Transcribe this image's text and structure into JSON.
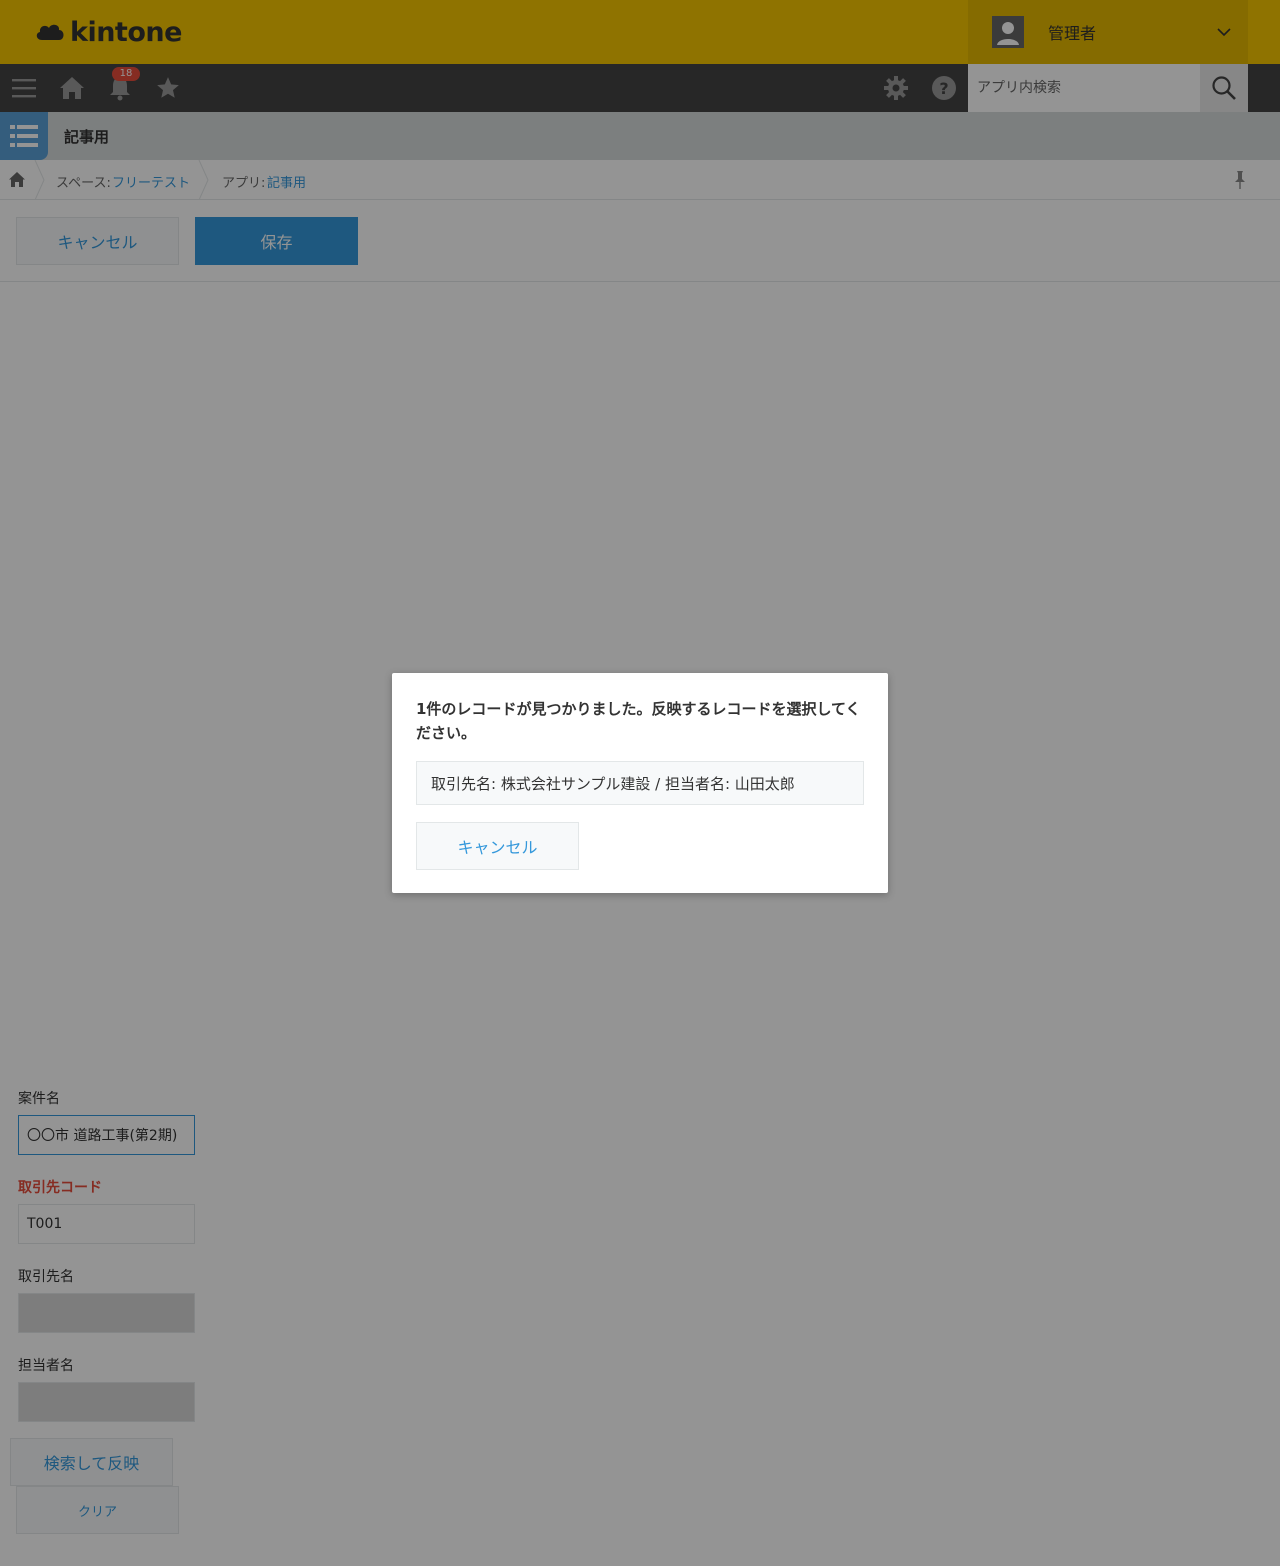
{
  "colors": {
    "brand": "#f6c700",
    "nav_bg": "#444444",
    "link": "#3498db",
    "required": "#e74c3c"
  },
  "header": {
    "logo_text": "kintone",
    "user_name": "管理者"
  },
  "navbar": {
    "icons": [
      "menu-icon",
      "home-icon",
      "bell-icon",
      "star-icon",
      "gear-icon",
      "help-icon",
      "search-icon"
    ],
    "notification_count": "18",
    "search_placeholder": "アプリ内検索"
  },
  "app": {
    "title": "記事用"
  },
  "breadcrumb": {
    "space_label": "スペース:",
    "space_name": "フリーテスト",
    "app_label": "アプリ:",
    "app_name": "記事用"
  },
  "toolbar": {
    "cancel_label": "キャンセル",
    "save_label": "保存"
  },
  "form": {
    "fields": [
      {
        "label": "案件名",
        "value": "〇〇市 道路工事(第2期)",
        "required": false
      },
      {
        "label": "取引先コード",
        "value": "T001",
        "required": true
      },
      {
        "label": "取引先名",
        "value": "",
        "required": false
      },
      {
        "label": "担当者名",
        "value": "",
        "required": false
      }
    ],
    "lookup_button": "検索して反映",
    "clear_button": "クリア"
  },
  "dialog": {
    "message": "1件のレコードが見つかりました。反映するレコードを選択してください。",
    "record": "取引先名: 株式会社サンプル建設 / 担当者名: 山田太郎",
    "cancel_label": "キャンセル"
  }
}
